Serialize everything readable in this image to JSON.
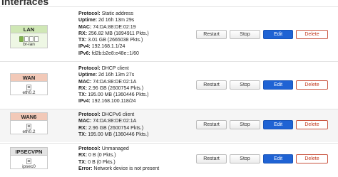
{
  "section_title": "Interfaces",
  "buttons": {
    "restart": "Restart",
    "stop": "Stop",
    "edit": "Edit",
    "delete": "Delete"
  },
  "interfaces": [
    {
      "name": "LAN",
      "device": "br-lan",
      "icon_style": "bridge",
      "details": [
        {
          "key": "Protocol:",
          "value": "Static address"
        },
        {
          "key": "Uptime:",
          "value": "2d 16h 13m 29s"
        },
        {
          "key": "MAC:",
          "value": "74:DA:88:DE:02:19"
        },
        {
          "key": "RX:",
          "value": "256.82 MB (1894911 Pkts.)"
        },
        {
          "key": "TX:",
          "value": "3.01 GB (2665038 Pkts.)"
        },
        {
          "key": "IPv4:",
          "value": "192.168.1.1/24"
        },
        {
          "key": "IPv6:",
          "value": "fd2b:b2e8:e48e::1/60"
        }
      ]
    },
    {
      "name": "WAN",
      "device": "eth0.2",
      "icon_style": "ethernet",
      "details": [
        {
          "key": "Protocol:",
          "value": "DHCP client"
        },
        {
          "key": "Uptime:",
          "value": "2d 16h 13m 27s"
        },
        {
          "key": "MAC:",
          "value": "74:DA:88:DE:02:1A"
        },
        {
          "key": "RX:",
          "value": "2.96 GB (2600754 Pkts.)"
        },
        {
          "key": "TX:",
          "value": "195.00 MB (1360446 Pkts.)"
        },
        {
          "key": "IPv4:",
          "value": "192.168.100.118/24"
        }
      ]
    },
    {
      "name": "WAN6",
      "device": "eth0.2",
      "icon_style": "ethernet",
      "details": [
        {
          "key": "Protocol:",
          "value": "DHCPv6 client"
        },
        {
          "key": "MAC:",
          "value": "74:DA:88:DE:02:1A"
        },
        {
          "key": "RX:",
          "value": "2.96 GB (2600754 Pkts.)"
        },
        {
          "key": "TX:",
          "value": "195.00 MB (1360446 Pkts.)"
        }
      ]
    },
    {
      "name": "IPSECVPN",
      "device": "ipsec0",
      "icon_style": "ethernet",
      "details": [
        {
          "key": "Protocol:",
          "value": "Unmanaged"
        },
        {
          "key": "RX:",
          "value": "0 B (0 Pkts.)"
        },
        {
          "key": "TX:",
          "value": "0 B (0 Pkts.)"
        },
        {
          "key": "Error:",
          "value": "Network device is not present"
        }
      ]
    }
  ]
}
